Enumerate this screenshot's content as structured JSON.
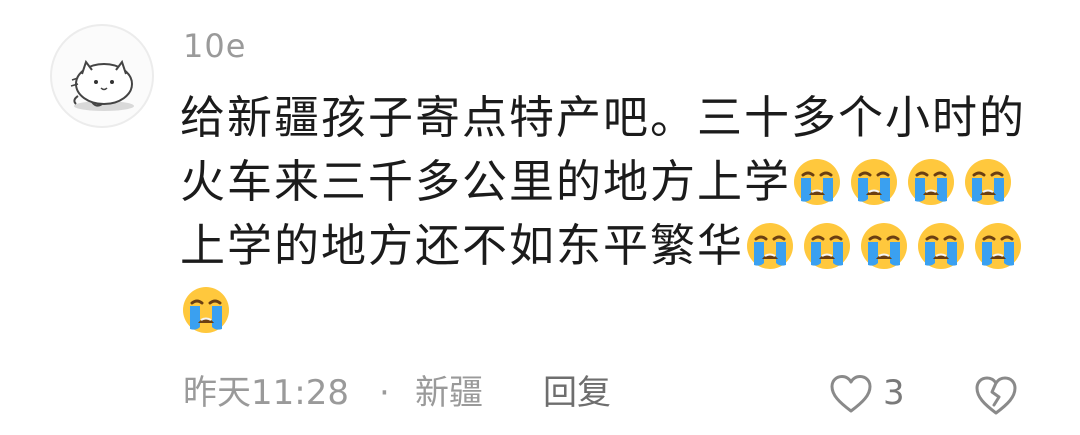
{
  "comment": {
    "username": "10e",
    "text_line1": "给新疆孩子寄点特产吧。三十多个小时的",
    "text_line2": "火车来三千多公里的地方上学",
    "text_line3": "上学的地方还不如东平繁华",
    "emoji_name": "loudly-crying-face",
    "time": "昨天11:28",
    "separator": "·",
    "location": "新疆",
    "reply_label": "回复",
    "like_count": "3",
    "colors": {
      "text": "#1b1b1b",
      "meta": "#9a9a9a",
      "emoji_face": "#ffc83d",
      "emoji_tears": "#3aa0f0"
    }
  }
}
